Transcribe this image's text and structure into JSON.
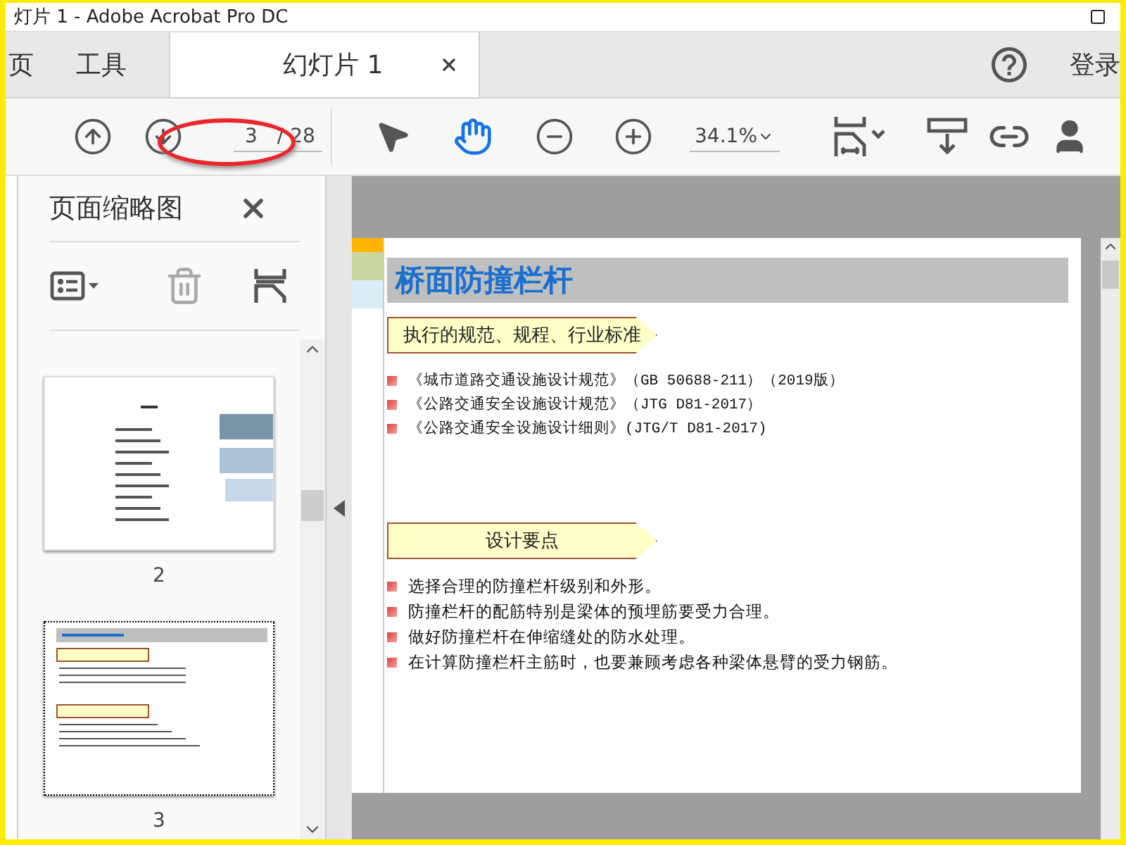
{
  "window": {
    "title": "灯片 1 - Adobe Acrobat Pro DC"
  },
  "tabs": [
    {
      "label": "页",
      "selected": false
    },
    {
      "label": "工具",
      "selected": false
    },
    {
      "label": "幻灯片 1",
      "selected": true,
      "closable": true
    }
  ],
  "account": {
    "label": "登录"
  },
  "toolbar": {
    "page": {
      "value": "3",
      "total": "/ 28",
      "highlighted": true
    },
    "hand_tool": {
      "selected": true
    },
    "zoom": {
      "value": "34.1%"
    }
  },
  "sidebar": {
    "title": "页面缩略图",
    "thumbnails": [
      {
        "label": "2",
        "kind": "contents",
        "selected": false
      },
      {
        "label": "3",
        "kind": "slide",
        "selected": true
      }
    ]
  },
  "slide": {
    "title": "桥面防撞栏杆",
    "sections": [
      {
        "heading": "执行的规范、规程、行业标准",
        "items": [
          "《城市道路交通设施设计规范》（GB 50688-211）（2019版）",
          "《公路交通安全设施设计规范》（JTG D81-2017）",
          "《公路交通安全设施设计细则》(JTG/T D81-2017)"
        ],
        "kind": "references"
      },
      {
        "heading": "设计要点",
        "items": [
          "选择合理的防撞栏杆级别和外形。",
          "防撞栏杆的配筋特别是梁体的预埋筋要受力合理。",
          "做好防撞栏杆在伸缩缝处的防水处理。",
          "在计算防撞栏杆主筋时，也要兼顾考虑各种梁体悬臂的受力钢筋。"
        ],
        "kind": "points"
      }
    ]
  }
}
